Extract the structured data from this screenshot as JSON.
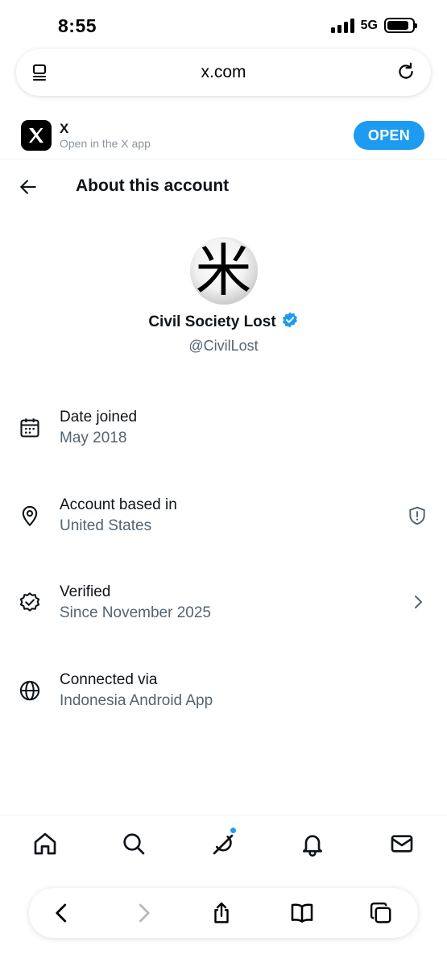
{
  "status_bar": {
    "time": "8:55",
    "network": "5G",
    "signal_bars": 4,
    "battery_level": 0.85
  },
  "browser": {
    "url": "x.com"
  },
  "app_banner": {
    "app_name": "X",
    "subtitle": "Open in the X app",
    "open_label": "OPEN",
    "accent_color": "#1d9bf0"
  },
  "header": {
    "title": "About this account"
  },
  "profile": {
    "display_name": "Civil Society Lost",
    "handle": "@CivilLost",
    "verified": true,
    "avatar_glyph": "米"
  },
  "info": {
    "date_joined": {
      "label": "Date joined",
      "value": "May 2018",
      "icon": "calendar-icon"
    },
    "based_in": {
      "label": "Account based in",
      "value": "United States",
      "icon": "location-pin-icon",
      "trailing_icon": "shield-alert-icon"
    },
    "verified": {
      "label": "Verified",
      "value": "Since November 2025",
      "icon": "verified-badge-icon",
      "trailing_icon": "chevron-right-icon"
    },
    "connected": {
      "label": "Connected via",
      "value": "Indonesia Android App",
      "icon": "globe-icon"
    }
  },
  "bottom_nav": {
    "items": [
      "home-icon",
      "search-icon",
      "grok-icon",
      "bell-icon",
      "mail-icon"
    ],
    "grok_has_dot": true
  },
  "browser_toolbar": {
    "items": [
      "back-icon",
      "forward-icon",
      "share-icon",
      "bookmarks-icon",
      "tabs-icon"
    ]
  }
}
